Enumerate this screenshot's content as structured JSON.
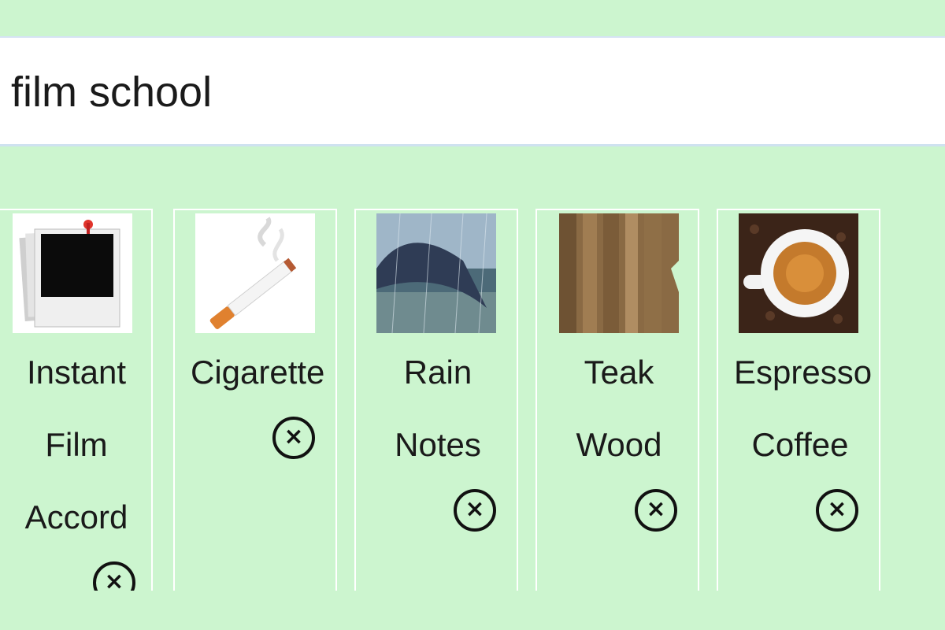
{
  "search": {
    "query": "film school"
  },
  "cards": [
    {
      "lines": [
        "Instant",
        "Film",
        "Accord"
      ],
      "icon": "polaroid-photos-icon",
      "remove_glyph": "×"
    },
    {
      "lines": [
        "Cigarette"
      ],
      "icon": "cigarette-icon",
      "remove_glyph": "×"
    },
    {
      "lines": [
        "Rain",
        "Notes"
      ],
      "icon": "rain-umbrella-icon",
      "remove_glyph": "×"
    },
    {
      "lines": [
        "Teak",
        "Wood"
      ],
      "icon": "wood-texture-icon",
      "remove_glyph": "×"
    },
    {
      "lines": [
        "Espresso",
        "Coffee"
      ],
      "icon": "espresso-cup-icon",
      "remove_glyph": "×"
    }
  ],
  "colors": {
    "background": "#ccf5cf",
    "search_bg": "#ffffff",
    "text": "#1a1a1a",
    "card_border": "#ffffff"
  }
}
